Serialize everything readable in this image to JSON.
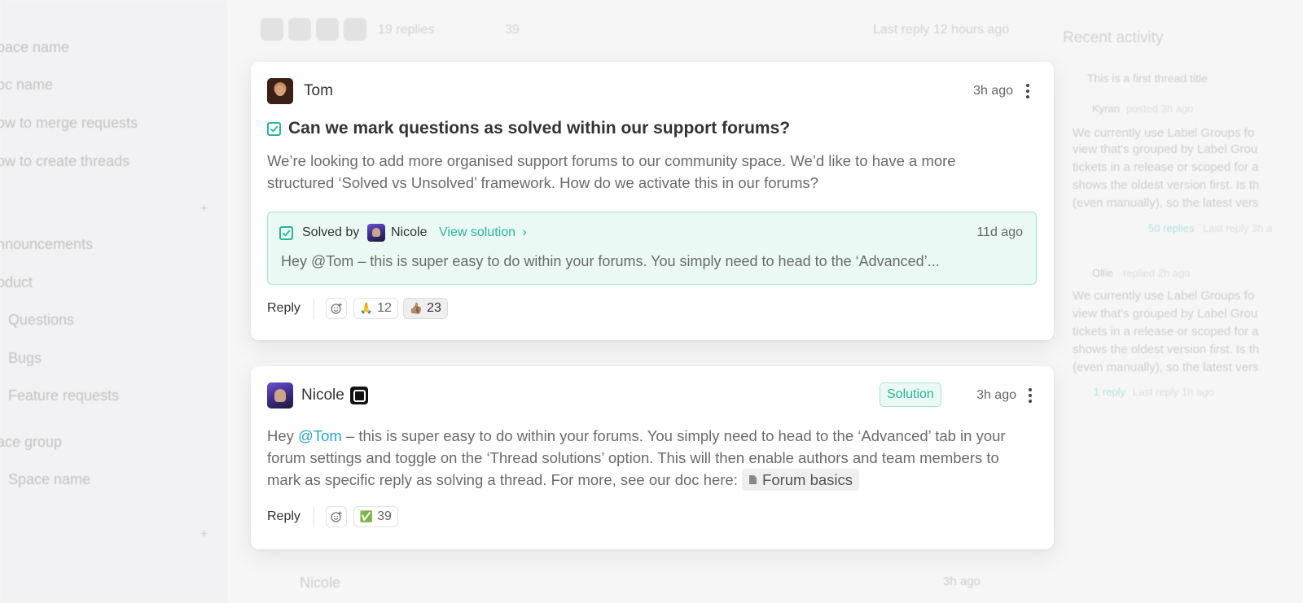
{
  "background": {
    "sidebar_items": [
      {
        "label": "pace name"
      },
      {
        "label": "oc name"
      },
      {
        "label": "ow to merge requests"
      },
      {
        "label": "ow to create threads"
      },
      {
        "label": "nnouncements"
      },
      {
        "label": "oduct"
      },
      {
        "label": "Questions"
      },
      {
        "label": "Bugs"
      },
      {
        "label": "Feature requests"
      },
      {
        "label": "ace group"
      },
      {
        "label": "Space name"
      }
    ],
    "topbar": {
      "replies": "19 replies",
      "likes": "39",
      "last_reply": "Last reply 12 hours ago"
    },
    "right_panel": {
      "title": "Recent activity",
      "thread": "This is a first thread title",
      "user1": "Kyran",
      "user1_action": "posted 3h ago",
      "excerpt_lines": [
        "We currently use Label Groups fo",
        "view that's grouped by Label Grou",
        "tickets in a release or scoped for a",
        "shows the oldest version first. Is th",
        "(even manually), so the latest vers"
      ],
      "user1_replies": "50 replies",
      "user1_last": "Last reply 3h a",
      "user2": "Ollie",
      "user2_action": "replied 2h ago",
      "user2_replies": "1 reply",
      "user2_last": "Last reply 1h ago"
    },
    "bottom": {
      "name": "Nicole",
      "time": "3h ago"
    }
  },
  "question": {
    "author": "Tom",
    "time": "3h ago",
    "title": "Can we mark questions as solved within our support forums?",
    "body": "We’re looking to add more organised support forums to our community space. We’d like to have a more structured ‘Solved vs Unsolved’ framework. How do we activate this in our forums?",
    "solution": {
      "solved_by_label": "Solved by",
      "solver": "Nicole",
      "view_label": "View solution",
      "time": "11d ago",
      "excerpt": "Hey @Tom – this is super easy to do within your forums. You simply need to head to the ‘Advanced’..."
    },
    "reply_label": "Reply",
    "reactions": [
      {
        "emoji": "🙏",
        "count": "12",
        "active": false
      },
      {
        "emoji": "👍🏽",
        "count": "23",
        "active": true
      }
    ]
  },
  "answer": {
    "author": "Nicole",
    "tag": "Solution",
    "time": "3h ago",
    "greeting": "Hey ",
    "mention": "@Tom",
    "body": " – this is super easy to do within your forums. You simply need to head to the ‘Advanced’ tab in your forum settings and toggle on the ‘Thread solutions’ option. This will then enable authors and team members to mark as specific reply as solving a thread. For more, see our doc here: ",
    "doc_link": "Forum basics",
    "reply_label": "Reply",
    "reactions": [
      {
        "emoji": "✅",
        "count": "39"
      }
    ]
  },
  "colors": {
    "accent": "#2bb59a",
    "mention": "#2aa6c4",
    "solution_bg": "#eaf9f4"
  }
}
